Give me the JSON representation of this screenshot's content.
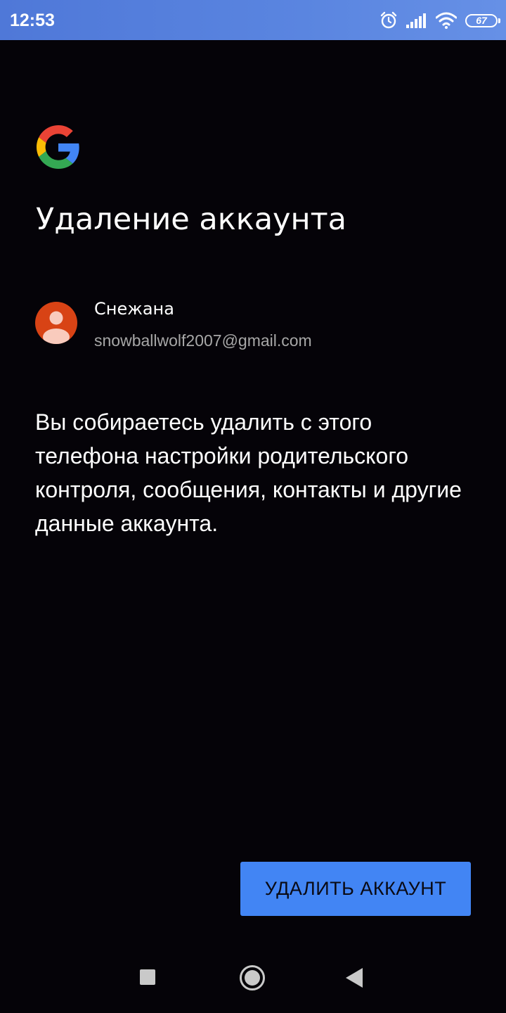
{
  "status_bar": {
    "time": "12:53",
    "battery_level": "67",
    "icons": [
      "alarm-icon",
      "signal-icon",
      "wifi-icon",
      "battery-icon"
    ]
  },
  "header": {
    "logo": "google-logo",
    "title": "Удаление аккаунта"
  },
  "account": {
    "name": "Снежана",
    "email": "snowballwolf2007@gmail.com",
    "avatar_color": "#d84315"
  },
  "message": {
    "text": "Вы собираетесь удалить с этого телефона настройки родительского контроля, сообщения, контакты и другие данные аккаунта."
  },
  "actions": {
    "delete_label": "УДАЛИТЬ АККАУНТ",
    "delete_color": "#4285f4"
  },
  "nav_bar": {
    "buttons": [
      "recents-icon",
      "home-icon",
      "back-icon"
    ]
  }
}
